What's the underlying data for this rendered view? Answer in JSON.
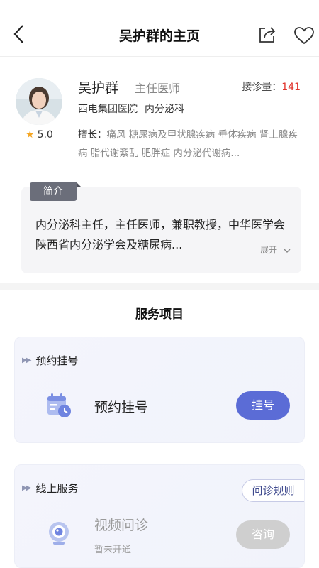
{
  "header": {
    "title": "吴护群的主页",
    "back_icon": "back-arrow-icon",
    "share_icon": "share-icon",
    "favorite_icon": "heart-icon"
  },
  "doctor": {
    "name": "吴护群",
    "title": "主任医师",
    "visits_label": "接诊量：",
    "visits_value": "141",
    "hospital": "西电集团医院",
    "department": "内分泌科",
    "rating": "5.0",
    "skills_label": "擅长：",
    "skills_text": "痛风  糖尿病及甲状腺疾病  垂体疾病  肾上腺疾病  脂代谢紊乱  肥胖症  内分泌代谢病..."
  },
  "intro": {
    "tag": "简介",
    "text": "内分泌科主任，主任医师，兼职教授，中华医学会陕西省内分泌学会及糖尿病...",
    "expand_label": "展开"
  },
  "services": {
    "section_title": "服务项目",
    "appointment": {
      "head": "预约挂号",
      "name": "预约挂号",
      "button": "挂号"
    },
    "online": {
      "head": "线上服务",
      "rules_button": "问诊规则",
      "name": "视频问诊",
      "status": "暂未开通",
      "button": "咨询"
    }
  },
  "colors": {
    "accent": "#5b6cd6",
    "visits": "#e0322b",
    "star": "#f5a623"
  }
}
